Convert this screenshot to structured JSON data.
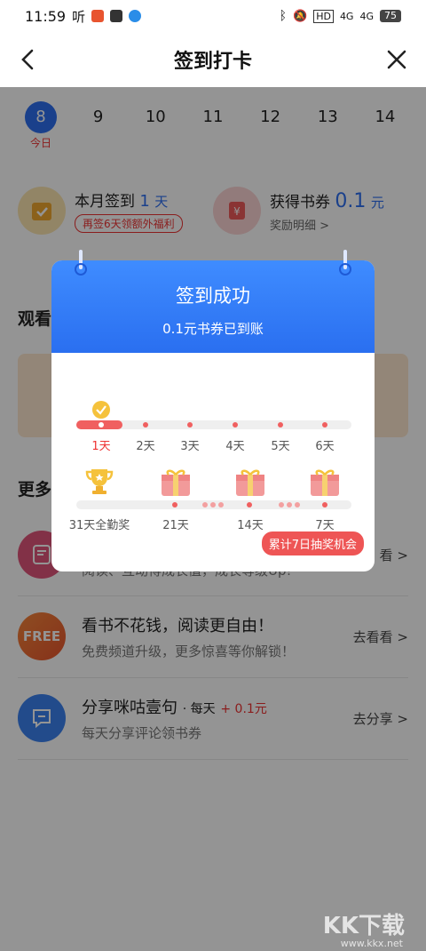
{
  "status_bar": {
    "time": "11:59",
    "listen": "听",
    "hd": "HD",
    "net1": "4G",
    "net2": "4G",
    "battery": "75"
  },
  "header": {
    "title": "签到打卡"
  },
  "dates": [
    {
      "num": "8",
      "sub": "今日"
    },
    {
      "num": "9"
    },
    {
      "num": "10"
    },
    {
      "num": "11"
    },
    {
      "num": "12"
    },
    {
      "num": "13"
    },
    {
      "num": "14"
    }
  ],
  "stats": {
    "month": {
      "label": "本月签到",
      "value": "1",
      "unit": "天",
      "pill": "再签6天领额外福利"
    },
    "coupon": {
      "label": "获得书券",
      "value": "0.1",
      "unit": "元",
      "link": "奖励明细 >"
    }
  },
  "sections": {
    "watch_prefix": "观看",
    "more_prefix": "更多"
  },
  "tasks": [
    {
      "icon_text": "FREE",
      "title": "看书不花钱，阅读更自由！",
      "desc": "免费频道升级，更多惊喜等你解锁！",
      "button": "去看看 >"
    },
    {
      "title": "分享咪咕壹句",
      "tag": "· 每天",
      "reward": "+ 0.1元",
      "desc": "每天分享评论领书券",
      "button": "去分享 >"
    }
  ],
  "partial_task": {
    "button": "看 >",
    "desc_partial": "阅读、互动得成长值，成长等级Up!"
  },
  "modal": {
    "title": "签到成功",
    "subtitle": "0.1元书券已到账",
    "row1": [
      "1天",
      "2天",
      "3天",
      "4天",
      "5天",
      "6天"
    ],
    "row2": [
      "31天全勤奖",
      "21天",
      "14天",
      "7天"
    ],
    "lottery": "累计7日抽奖机会"
  },
  "watermark": {
    "logo": "KK下载",
    "url": "www.kkx.net"
  },
  "colors": {
    "accent": "#2d6ef0",
    "red": "#e33333",
    "gold": "#f5c23c"
  }
}
